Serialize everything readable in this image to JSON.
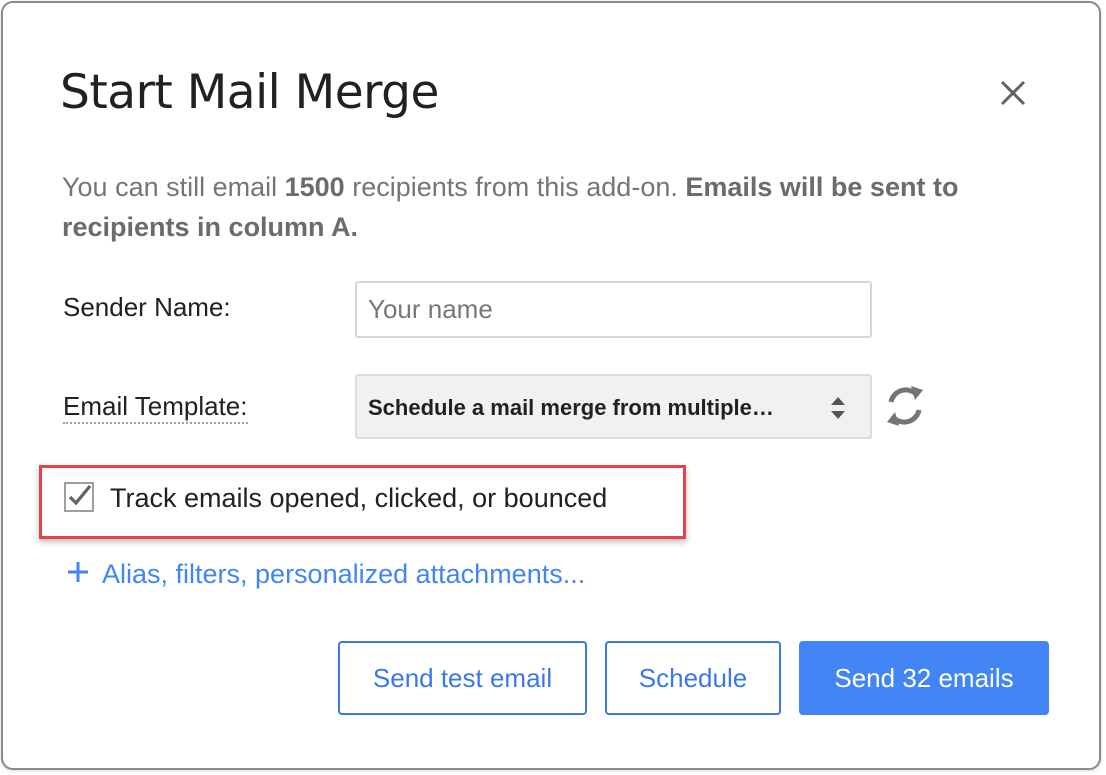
{
  "dialog": {
    "title": "Start Mail Merge",
    "close_icon": "close-icon"
  },
  "intro": {
    "part1": "You can still email ",
    "count": "1500",
    "part2": " recipients from this add-on. ",
    "bold": "Emails will be sent to recipients in column A."
  },
  "sender": {
    "label": "Sender Name:",
    "value": "",
    "placeholder": "Your name"
  },
  "template": {
    "label": "Email Template:",
    "selected": "Schedule a mail merge from multiple…",
    "refresh_icon": "refresh-icon"
  },
  "tracking": {
    "checked": true,
    "label": "Track emails opened, clicked, or bounced"
  },
  "more_options": {
    "label": "Alias, filters, personalized attachments..."
  },
  "buttons": {
    "test": "Send test email",
    "schedule": "Schedule",
    "send": "Send 32 emails"
  },
  "colors": {
    "accent": "#4285f4",
    "highlight": "#e8414a"
  }
}
